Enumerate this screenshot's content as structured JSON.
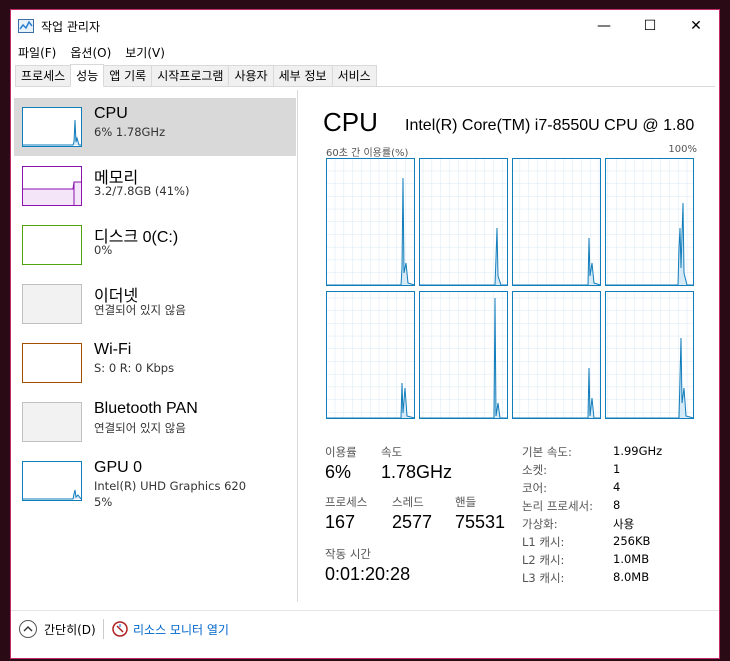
{
  "window": {
    "title": "작업 관리자",
    "minimize_glyph": "—",
    "maximize_glyph": "☐",
    "close_glyph": "✕"
  },
  "menu": [
    "파일(F)",
    "옵션(O)",
    "보기(V)"
  ],
  "tabs": [
    "프로세스",
    "성능",
    "앱 기록",
    "시작프로그램",
    "사용자",
    "세부 정보",
    "서비스"
  ],
  "active_tab": "성능",
  "sidebar": {
    "items": [
      {
        "title": "CPU",
        "sub": "6% 1.78GHz",
        "sub2": "",
        "color": "#117dbb",
        "selected": true
      },
      {
        "title": "메모리",
        "sub": "3.2/7.8GB (41%)",
        "sub2": "",
        "color": "#8b12ae",
        "selected": false
      },
      {
        "title": "디스크 0(C:)",
        "sub": "0%",
        "sub2": "",
        "color": "#4da60c",
        "selected": false
      },
      {
        "title": "이더넷",
        "sub": "연결되어 있지 않음",
        "sub2": "",
        "color": "#c0c0c0",
        "selected": false
      },
      {
        "title": "Wi-Fi",
        "sub": "S: 0 R: 0 Kbps",
        "sub2": "",
        "color": "#a74f01",
        "selected": false
      },
      {
        "title": "Bluetooth PAN",
        "sub": "연결되어 있지 않음",
        "sub2": "",
        "color": "#c0c0c0",
        "selected": false
      },
      {
        "title": "GPU 0",
        "sub": "Intel(R) UHD Graphics 620",
        "sub2": "5%",
        "color": "#117dbb",
        "selected": false
      }
    ]
  },
  "main": {
    "title": "CPU",
    "cpu_name": "Intel(R) Core(TM) i7-8550U CPU @ 1.80",
    "graph_caption_left": "60초 간 이용률(%)",
    "graph_caption_right": "100%",
    "stats": {
      "usage_label": "이용률",
      "usage_value": "6%",
      "speed_label": "속도",
      "speed_value": "1.78GHz",
      "processes_label": "프로세스",
      "processes_value": "167",
      "threads_label": "스레드",
      "threads_value": "2577",
      "handles_label": "핸들",
      "handles_value": "75531",
      "uptime_label": "작동 시간",
      "uptime_value": "0:01:20:28"
    },
    "details": [
      {
        "label": "기본 속도:",
        "value": "1.99GHz"
      },
      {
        "label": "소켓:",
        "value": "1"
      },
      {
        "label": "코어:",
        "value": "4"
      },
      {
        "label": "논리 프로세서:",
        "value": "8"
      },
      {
        "label": "가상화:",
        "value": "사용"
      },
      {
        "label": "L1 캐시:",
        "value": "256KB"
      },
      {
        "label": "L2 캐시:",
        "value": "1.0MB"
      },
      {
        "label": "L3 캐시:",
        "value": "8.0MB"
      }
    ]
  },
  "footer": {
    "collapse_label": "간단히(D)",
    "resmon_label": "리소스 모니터 열기"
  },
  "colors": {
    "cpu": "#117dbb",
    "memory": "#8b12ae",
    "disk": "#4da60c",
    "wifi": "#a74f01",
    "selected_bg": "#d9d9d9",
    "window_border": "#c42b6a"
  }
}
